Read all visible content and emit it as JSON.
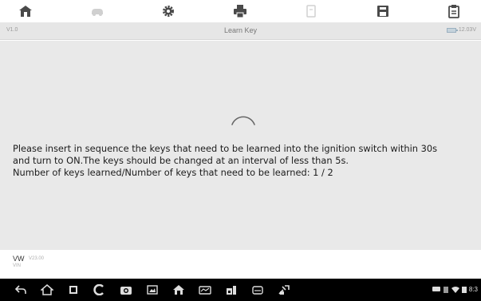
{
  "toolbar": {
    "icons": [
      "home-icon",
      "vehicle-icon",
      "settings-icon",
      "print-icon",
      "help-icon",
      "save-icon",
      "data-logging-icon"
    ]
  },
  "titlebar": {
    "version": "V1.0",
    "title": "Learn Key",
    "battery_text": "12.03V"
  },
  "main": {
    "instructions": [
      "Please insert in sequence the keys that need to be learned into the ignition switch within 30s",
      "and turn to ON.The keys should be changed at an interval of less than 5s.",
      "Number of keys learned/Number of keys that need to be learned: 1 / 2"
    ]
  },
  "footer": {
    "make": "VW",
    "make_sub": "V23.00",
    "vin": "VIN"
  },
  "navbar": {
    "icons": [
      "back-icon",
      "home-icon",
      "recent-apps-icon",
      "chrome-icon",
      "camera-icon",
      "screenshot-icon",
      "vehicle-menu-icon",
      "vci-icon",
      "shop-icon",
      "car-icon",
      "tools-icon"
    ],
    "status_text": "8:3"
  },
  "colors": {
    "toolbar_icon": "#4a4a4a",
    "toolbar_icon_faded": "#c8c8c8",
    "content_bg": "#e9e9e9",
    "titlebar_bg": "#e6e6e6",
    "navbar_bg": "#000000"
  }
}
